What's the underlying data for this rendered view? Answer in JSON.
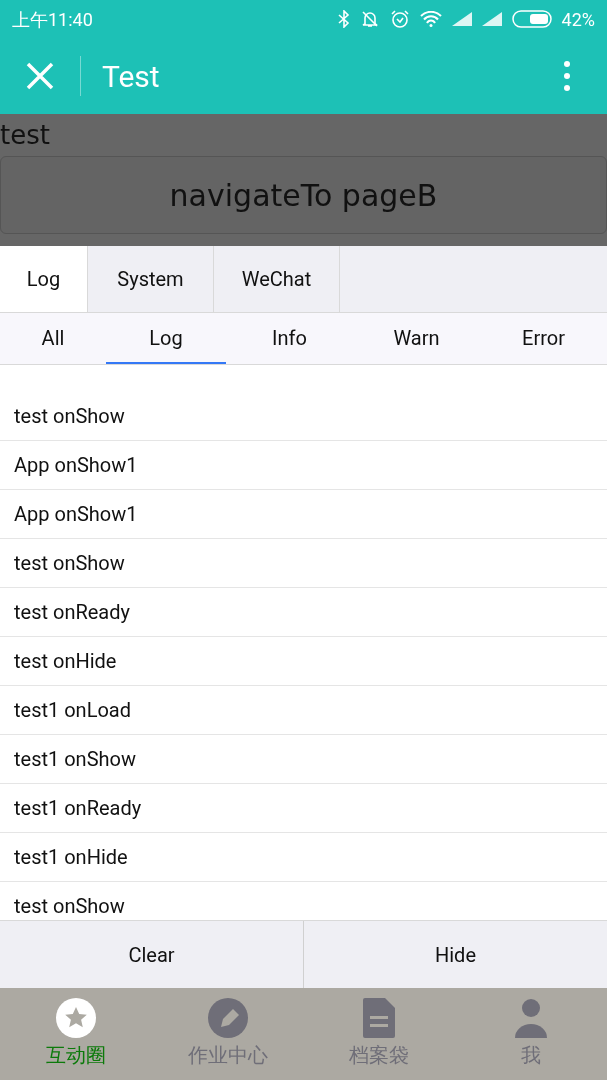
{
  "status_bar": {
    "time": "上午11:40",
    "battery": "42%"
  },
  "header": {
    "title": "Test"
  },
  "page": {
    "text": "test",
    "button": "navigateTo pageB"
  },
  "console": {
    "tabs": [
      {
        "label": "Log",
        "selected": true
      },
      {
        "label": "System",
        "selected": false
      },
      {
        "label": "WeChat",
        "selected": false
      }
    ],
    "filters": [
      {
        "label": "All",
        "selected": false
      },
      {
        "label": "Log",
        "selected": true
      },
      {
        "label": "Info",
        "selected": false
      },
      {
        "label": "Warn",
        "selected": false
      },
      {
        "label": "Error",
        "selected": false
      }
    ],
    "entries": [
      "test onShow",
      "App onShow1",
      "App onShow1",
      "test onShow",
      "test onReady",
      "test onHide",
      "test1 onLoad",
      "test1 onShow",
      "test1 onReady",
      "test1 onHide",
      "test onShow"
    ],
    "actions": [
      "Clear",
      "Hide"
    ]
  },
  "tab_bar": [
    {
      "label": "互动圈",
      "selected": true,
      "kind": "star"
    },
    {
      "label": "作业中心",
      "selected": false,
      "kind": "pen"
    },
    {
      "label": "档案袋",
      "selected": false,
      "kind": "file"
    },
    {
      "label": "我",
      "selected": false,
      "kind": "person"
    }
  ]
}
